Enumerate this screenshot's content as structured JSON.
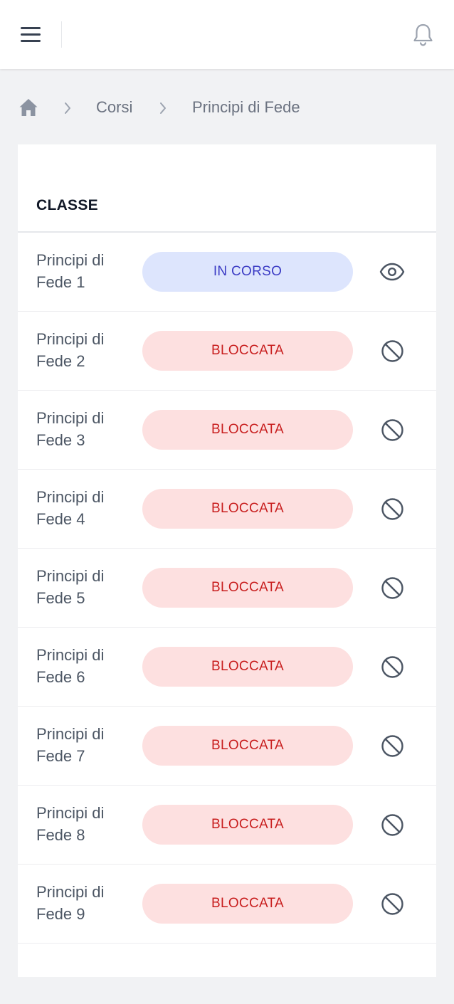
{
  "header": {
    "menu_icon": "hamburger-menu-icon",
    "notification_icon": "bell-icon"
  },
  "breadcrumb": {
    "home_icon": "home-icon",
    "items": [
      "Corsi",
      "Principi di Fede"
    ]
  },
  "table": {
    "column_header": "CLASSE",
    "rows": [
      {
        "name": "Principi di Fede 1",
        "status": "IN CORSO",
        "status_type": "in-progress",
        "action_icon": "eye-icon"
      },
      {
        "name": "Principi di Fede 2",
        "status": "BLOCCATA",
        "status_type": "locked",
        "action_icon": "blocked-icon"
      },
      {
        "name": "Principi di Fede 3",
        "status": "BLOCCATA",
        "status_type": "locked",
        "action_icon": "blocked-icon"
      },
      {
        "name": "Principi di Fede 4",
        "status": "BLOCCATA",
        "status_type": "locked",
        "action_icon": "blocked-icon"
      },
      {
        "name": "Principi di Fede 5",
        "status": "BLOCCATA",
        "status_type": "locked",
        "action_icon": "blocked-icon"
      },
      {
        "name": "Principi di Fede 6",
        "status": "BLOCCATA",
        "status_type": "locked",
        "action_icon": "blocked-icon"
      },
      {
        "name": "Principi di Fede 7",
        "status": "BLOCCATA",
        "status_type": "locked",
        "action_icon": "blocked-icon"
      },
      {
        "name": "Principi di Fede 8",
        "status": "BLOCCATA",
        "status_type": "locked",
        "action_icon": "blocked-icon"
      },
      {
        "name": "Principi di Fede 9",
        "status": "BLOCCATA",
        "status_type": "locked",
        "action_icon": "blocked-icon"
      }
    ]
  },
  "colors": {
    "in_progress_bg": "#dde5fd",
    "in_progress_text": "#3b3bc4",
    "locked_bg": "#fde0e0",
    "locked_text": "#c81e1e"
  }
}
